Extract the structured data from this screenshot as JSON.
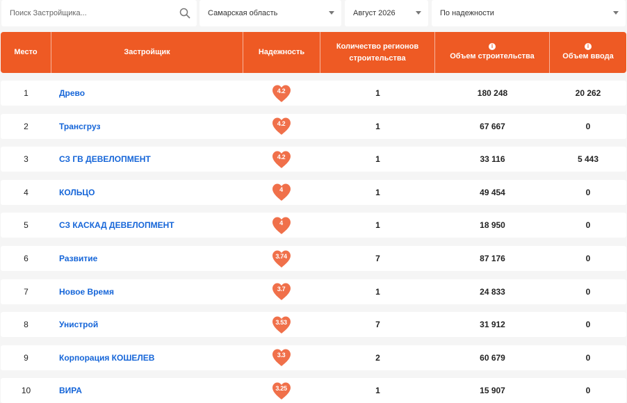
{
  "filters": {
    "search_placeholder": "Поиск Застройщика...",
    "region": "Самарская область",
    "month": "Август 2026",
    "sort": "По надежности"
  },
  "colors": {
    "accent": "#ee5a24",
    "link": "#1565d8",
    "heart": "#f0704a"
  },
  "icons": {
    "search": "search-icon",
    "dropdown": "chevron-down-icon",
    "info": "info-icon",
    "reliability": "heart-icon"
  },
  "table": {
    "headers": {
      "place": "Место",
      "developer": "Застройщик",
      "reliability": "Надежность",
      "regions_line1": "Количество регионов",
      "regions_line2": "строительства",
      "volume": "Объем строительства",
      "input": "Объем ввода"
    },
    "rows": [
      {
        "place": "1",
        "name": "Древо",
        "rating": "4.2",
        "regions": "1",
        "volume": "180 248",
        "input": "20 262"
      },
      {
        "place": "2",
        "name": "Трансгруз",
        "rating": "4.2",
        "regions": "1",
        "volume": "67 667",
        "input": "0"
      },
      {
        "place": "3",
        "name": "СЗ ГВ ДЕВЕЛОПМЕНТ",
        "rating": "4.2",
        "regions": "1",
        "volume": "33 116",
        "input": "5 443"
      },
      {
        "place": "4",
        "name": "КОЛЬЦО",
        "rating": "4",
        "regions": "1",
        "volume": "49 454",
        "input": "0"
      },
      {
        "place": "5",
        "name": "СЗ КАСКАД ДЕВЕЛОПМЕНТ",
        "rating": "4",
        "regions": "1",
        "volume": "18 950",
        "input": "0"
      },
      {
        "place": "6",
        "name": "Развитие",
        "rating": "3.74",
        "regions": "7",
        "volume": "87 176",
        "input": "0"
      },
      {
        "place": "7",
        "name": "Новое Время",
        "rating": "3.7",
        "regions": "1",
        "volume": "24 833",
        "input": "0"
      },
      {
        "place": "8",
        "name": "Унистрой",
        "rating": "3.53",
        "regions": "7",
        "volume": "31 912",
        "input": "0"
      },
      {
        "place": "9",
        "name": "Корпорация КОШЕЛЕВ",
        "rating": "3.3",
        "regions": "2",
        "volume": "60 679",
        "input": "0"
      },
      {
        "place": "10",
        "name": "ВИРА",
        "rating": "3.25",
        "regions": "1",
        "volume": "15 907",
        "input": "0"
      }
    ]
  }
}
